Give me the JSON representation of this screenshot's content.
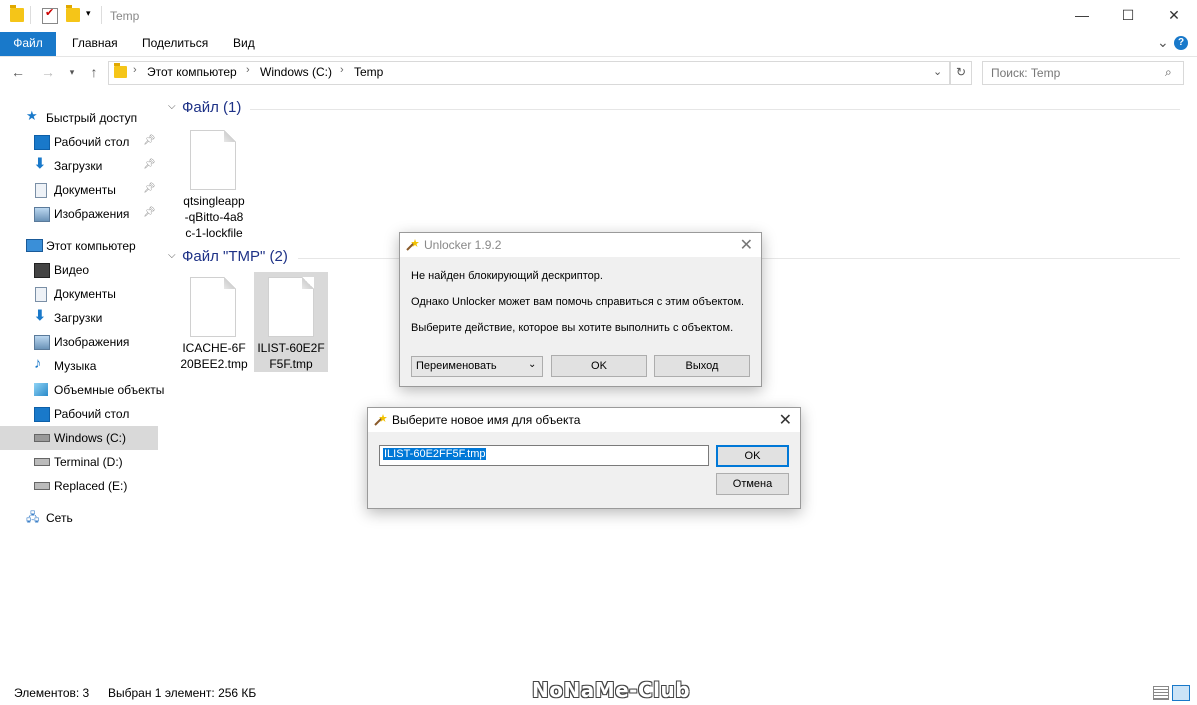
{
  "window": {
    "title": "Temp",
    "minimize": "—",
    "maximize": "☐",
    "close": "✕"
  },
  "ribbon": {
    "tabs": [
      "Файл",
      "Главная",
      "Поделиться",
      "Вид"
    ],
    "collapse": "⌄",
    "help": "?"
  },
  "address": {
    "crumbs": [
      "Этот компьютер",
      "Windows (C:)",
      "Temp"
    ],
    "search_placeholder": "Поиск: Temp"
  },
  "sidebar": {
    "quick_access": "Быстрый доступ",
    "quick_items": [
      "Рабочий стол",
      "Загрузки",
      "Документы",
      "Изображения"
    ],
    "this_pc": "Этот компьютер",
    "pc_items": [
      "Видео",
      "Документы",
      "Загрузки",
      "Изображения",
      "Музыка",
      "Объемные объекты",
      "Рабочий стол",
      "Windows (C:)",
      "Terminal (D:)",
      "Replaced (E:)"
    ],
    "network": "Сеть"
  },
  "groups": [
    {
      "title": "Файл (1)",
      "files": [
        {
          "name": "qtsingleapp-qBitto-4a8c-1-lockfile",
          "lines": [
            "qtsingleapp",
            "-qBitto-4a8",
            "c-1-lockfile"
          ]
        }
      ]
    },
    {
      "title": "Файл \"TMP\" (2)",
      "files": [
        {
          "name": "ICACHE-6F20BEE2.tmp",
          "lines": [
            "ICACHE-6F",
            "20BEE2.tmp"
          ]
        },
        {
          "name": "ILIST-60E2FF5F.tmp",
          "lines": [
            "ILIST-60E2F",
            "F5F.tmp"
          ]
        }
      ]
    }
  ],
  "status": {
    "items": "Элементов: 3",
    "selected": "Выбран 1 элемент: 256 КБ"
  },
  "unlocker": {
    "title": "Unlocker 1.9.2",
    "line1": "Не найден блокирующий дескриптор.",
    "line2": "Однако Unlocker может вам помочь справиться с этим объектом.",
    "line3": "Выберите действие, которое вы хотите выполнить с объектом.",
    "action_selected": "Переименовать",
    "ok": "OK",
    "exit": "Выход"
  },
  "rename": {
    "title": "Выберите новое имя для объекта",
    "value": "ILIST-60E2FF5F.tmp",
    "ok": "OK",
    "cancel": "Отмена"
  },
  "watermark": "NoNaMe-Club",
  "colors": {
    "accent": "#1979ca",
    "selection": "#0078d7",
    "group_header": "#1e3287"
  }
}
